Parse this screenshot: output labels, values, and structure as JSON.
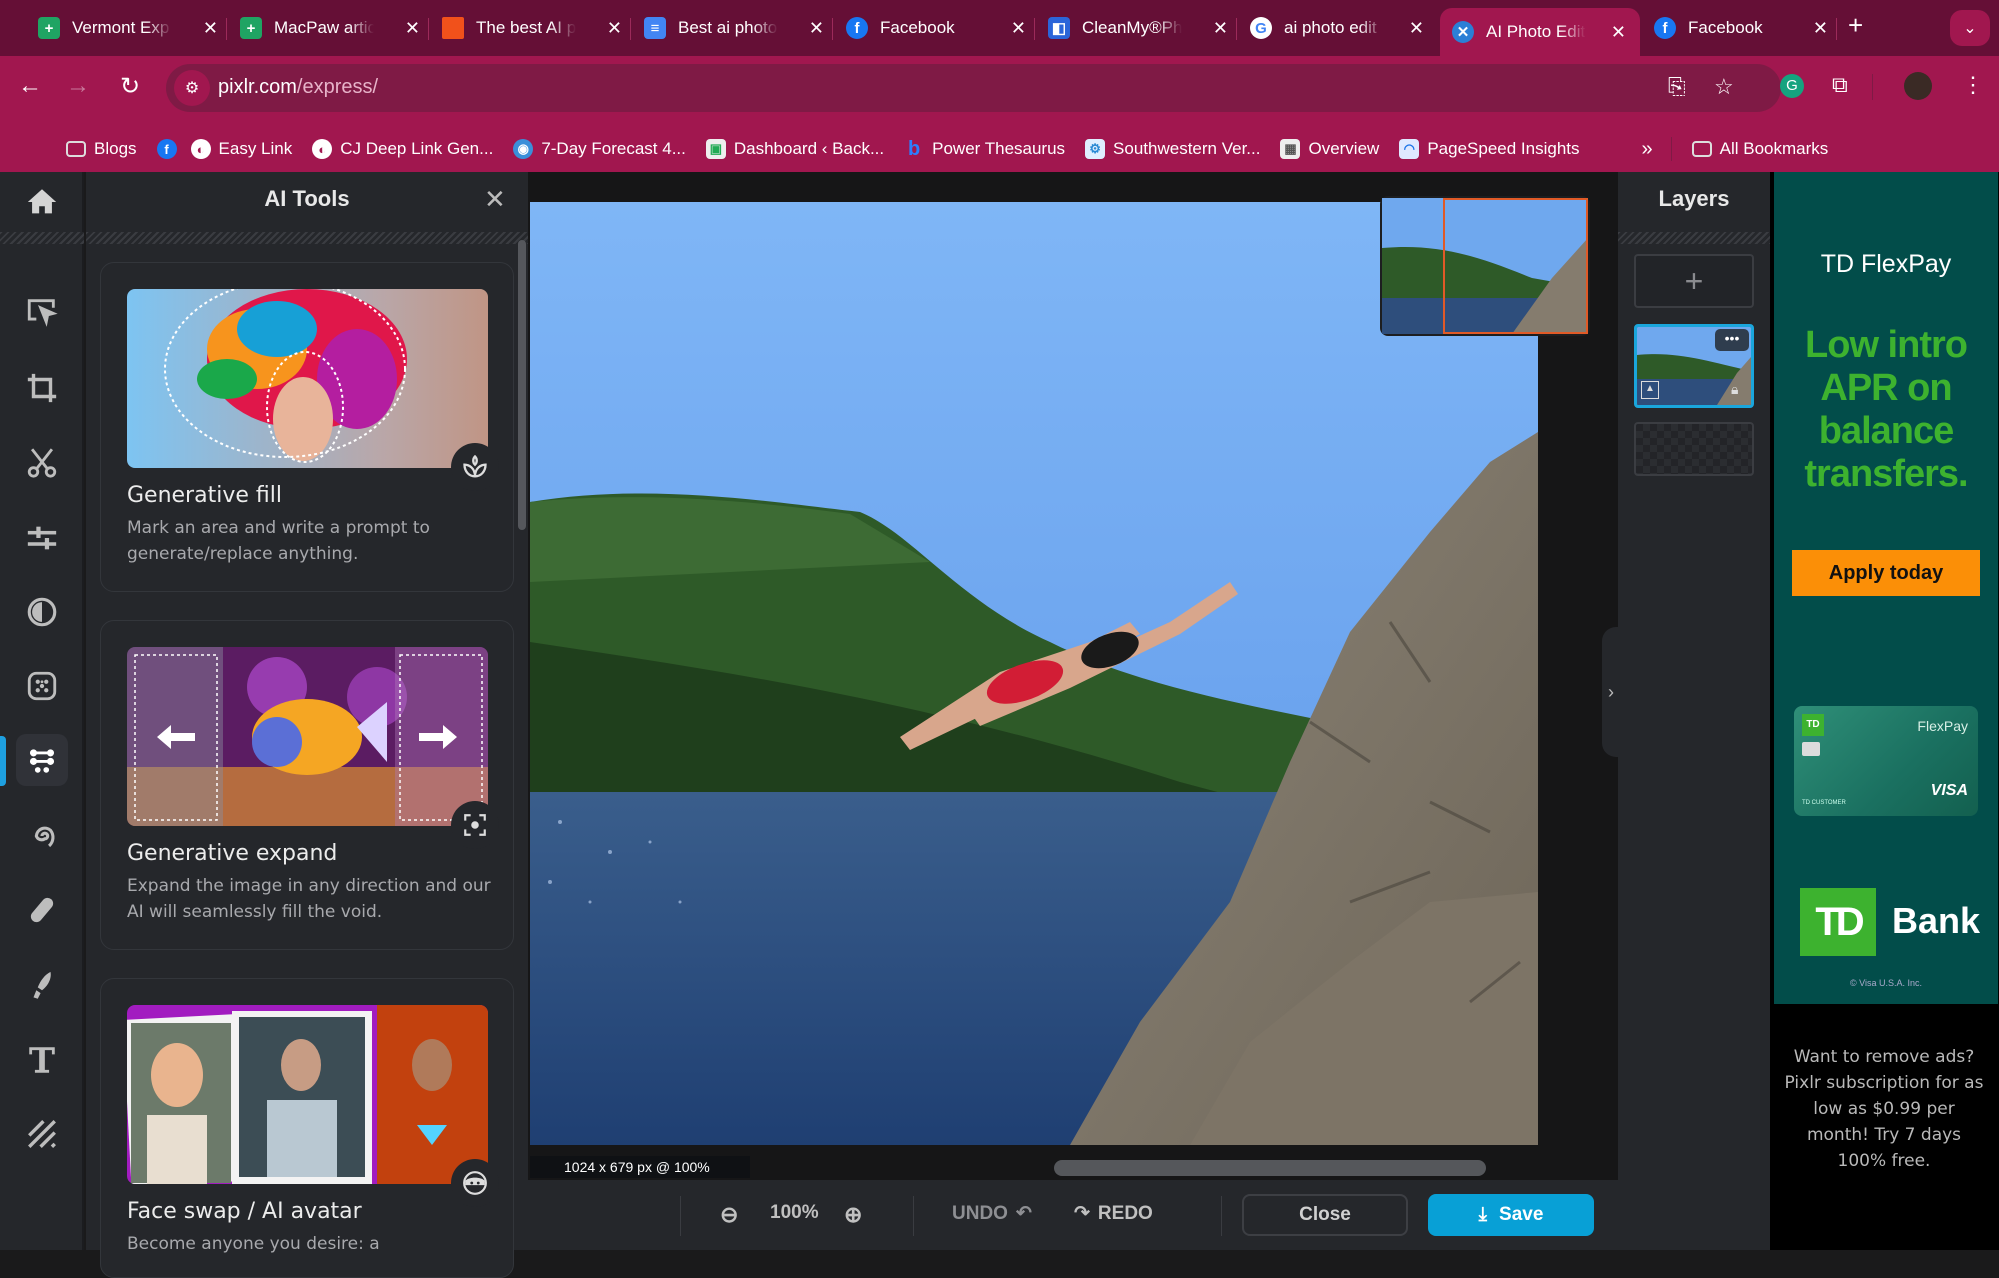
{
  "browser": {
    "tabs": [
      {
        "title": "Vermont Exp",
        "icon": "sheets-icon",
        "color": "#1fa463"
      },
      {
        "title": "MacPaw artic",
        "icon": "sheets-icon",
        "color": "#1fa463"
      },
      {
        "title": "The best AI p",
        "icon": "orange-square-icon",
        "color": "#f1511b"
      },
      {
        "title": "Best ai photo",
        "icon": "docs-icon",
        "color": "#4285f4"
      },
      {
        "title": "Facebook",
        "icon": "facebook-icon",
        "color": "#1877f2"
      },
      {
        "title": "CleanMy®Ph",
        "icon": "cleanmymac-icon",
        "color": "#2b65d9"
      },
      {
        "title": "ai photo edit",
        "icon": "google-icon",
        "color": "#ffffff"
      },
      {
        "title": "AI Photo Edit",
        "icon": "pixlr-icon",
        "color": "#2b7fd6",
        "active": true
      },
      {
        "title": "Facebook",
        "icon": "facebook-icon",
        "color": "#1877f2"
      }
    ],
    "url_host": "pixlr.com",
    "url_path": "/express/",
    "bookmarks": [
      {
        "label": "Blogs",
        "icon": "folder-icon"
      },
      {
        "label": "",
        "icon": "facebook-icon"
      },
      {
        "label": "Easy Link",
        "icon": "globe-icon"
      },
      {
        "label": "CJ Deep Link Gen...",
        "icon": "globe-icon"
      },
      {
        "label": "7-Day Forecast 4...",
        "icon": "noaa-icon"
      },
      {
        "label": "Dashboard ‹ Back...",
        "icon": "site-icon"
      },
      {
        "label": "Power Thesaurus",
        "icon": "bing-icon"
      },
      {
        "label": "Southwestern Ver...",
        "icon": "site-icon"
      },
      {
        "label": "Overview",
        "icon": "calendar-icon"
      },
      {
        "label": "PageSpeed Insights",
        "icon": "pagespeed-icon"
      }
    ],
    "all_bookmarks": "All Bookmarks",
    "overflow": "»"
  },
  "ai_panel": {
    "title": "AI Tools",
    "cards": [
      {
        "title": "Generative fill",
        "desc": "Mark an area and write a prompt to generate/replace anything."
      },
      {
        "title": "Generative expand",
        "desc": "Expand the image in any direction and our AI will seamlessly fill the void."
      },
      {
        "title": "Face swap / AI avatar",
        "desc": "Become anyone you desire: a"
      }
    ]
  },
  "layers": {
    "title": "Layers",
    "add_label": "+"
  },
  "canvas": {
    "dimensions": "1024 x 679 px @ 100%"
  },
  "bottombar": {
    "zoom": "100%",
    "undo": "UNDO",
    "redo": "REDO",
    "close": "Close",
    "save": "Save"
  },
  "ad": {
    "brand": "TD FlexPay",
    "headline": "Low intro APR on balance transfers.",
    "cta": "Apply today",
    "card_name": "FlexPay",
    "card_network": "VISA",
    "card_holder": "TD CUSTOMER",
    "logo": "TD",
    "bank": "Bank",
    "legal": "© Visa U.S.A. Inc.",
    "promo": "Want to remove ads? Pixlr subscription for as low as $0.99 per month! Try 7 days 100% free."
  },
  "colors": {
    "accent": "#08a0d6",
    "chrome": "#a1174f",
    "tabstrip": "#650f36",
    "ad_green": "#3db22f",
    "ad_cta": "#fb8f07"
  }
}
